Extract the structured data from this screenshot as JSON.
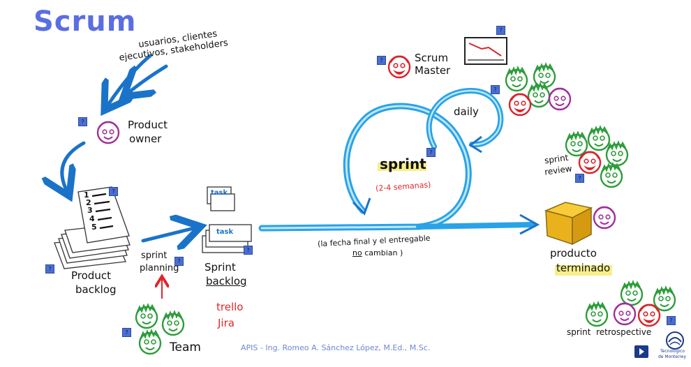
{
  "title": "Scrum",
  "stakeholders_line1": "usuarios, clientes",
  "stakeholders_line2": "ejecutivos, stakeholders",
  "product_owner_l1": "Product",
  "product_owner_l2": "owner",
  "product_backlog_l1": "Product",
  "product_backlog_l2": "backlog",
  "backlog_numbers": [
    "1",
    "2",
    "3",
    "4",
    "5"
  ],
  "sprint_planning_l1": "sprint",
  "sprint_planning_l2": "planning",
  "task_label": "task",
  "sprint_backlog_l1": "Sprint",
  "sprint_backlog_l2": "backlog",
  "tools_l1": "trello",
  "tools_l2": "Jira",
  "team_label": "Team",
  "sprint_label": "sprint",
  "sprint_duration": "(2-4 semanas)",
  "daily_label": "daily",
  "scrum_master_l1": "Scrum",
  "scrum_master_l2": "Master",
  "note_l1": "(la fecha final y el entregable",
  "note_l2_no": "no",
  "note_l2_rest": "cambian )",
  "sprint_review_l1": "sprint",
  "sprint_review_l2": "review",
  "product_done_l1": "producto",
  "product_done_l2": "terminado",
  "retro_label": "sprint  retrospective",
  "footer": "APIS - Ing. Romeo A. Sánchez López, M.Ed., M.Sc.",
  "logo_l1": "Tecnológico",
  "logo_l2": "de Monterrey",
  "help_glyph": "?",
  "colors": {
    "title": "#5b6ee1",
    "arrow": "#1a73c9",
    "loop": "#29a3e6",
    "highlight": "#f6ef8a",
    "red_text": "#e0262a",
    "green": "#2c9c3a",
    "purple": "#a12d9c",
    "red": "#d8242b"
  }
}
